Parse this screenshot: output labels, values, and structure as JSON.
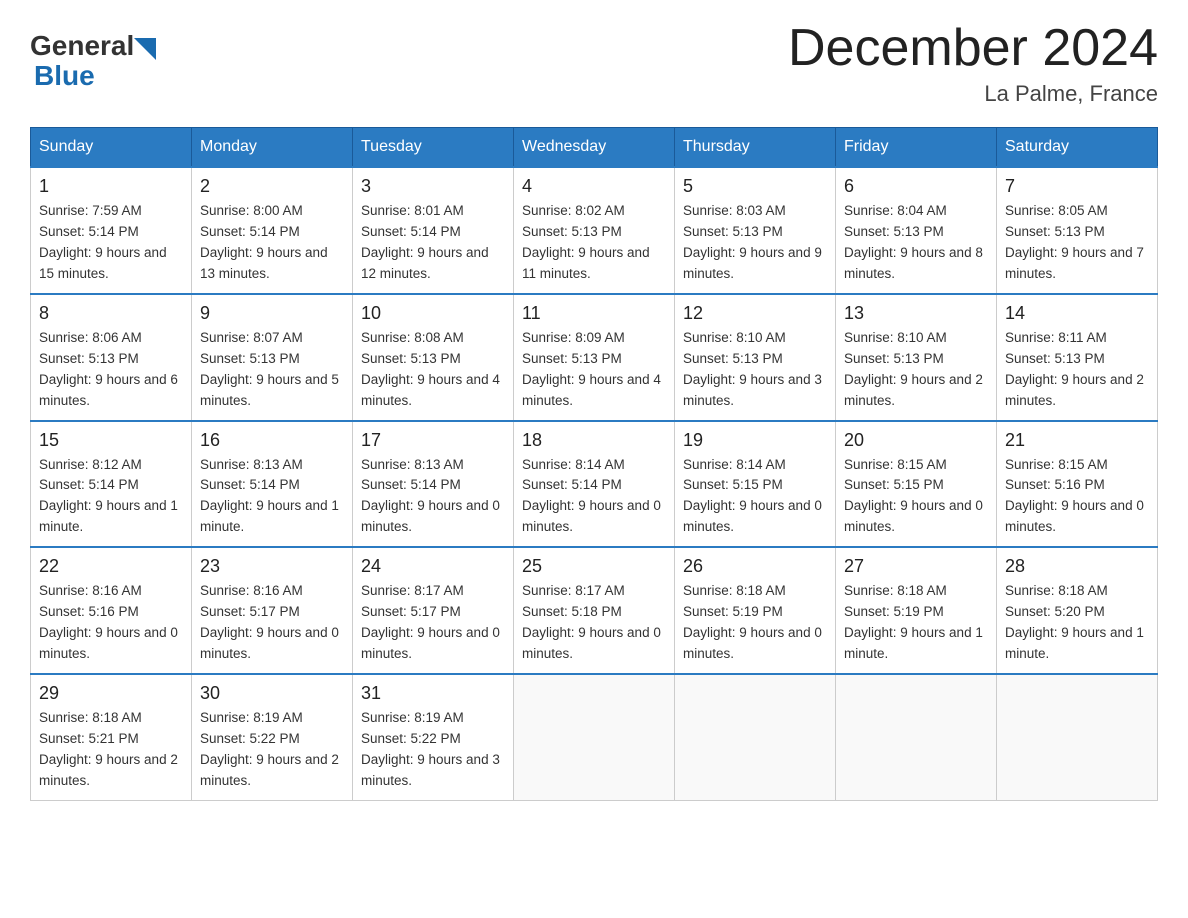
{
  "header": {
    "logo_general": "General",
    "logo_blue": "Blue",
    "title": "December 2024",
    "subtitle": "La Palme, France"
  },
  "weekdays": [
    "Sunday",
    "Monday",
    "Tuesday",
    "Wednesday",
    "Thursday",
    "Friday",
    "Saturday"
  ],
  "weeks": [
    [
      {
        "day": "1",
        "sunrise": "7:59 AM",
        "sunset": "5:14 PM",
        "daylight": "9 hours and 15 minutes."
      },
      {
        "day": "2",
        "sunrise": "8:00 AM",
        "sunset": "5:14 PM",
        "daylight": "9 hours and 13 minutes."
      },
      {
        "day": "3",
        "sunrise": "8:01 AM",
        "sunset": "5:14 PM",
        "daylight": "9 hours and 12 minutes."
      },
      {
        "day": "4",
        "sunrise": "8:02 AM",
        "sunset": "5:13 PM",
        "daylight": "9 hours and 11 minutes."
      },
      {
        "day": "5",
        "sunrise": "8:03 AM",
        "sunset": "5:13 PM",
        "daylight": "9 hours and 9 minutes."
      },
      {
        "day": "6",
        "sunrise": "8:04 AM",
        "sunset": "5:13 PM",
        "daylight": "9 hours and 8 minutes."
      },
      {
        "day": "7",
        "sunrise": "8:05 AM",
        "sunset": "5:13 PM",
        "daylight": "9 hours and 7 minutes."
      }
    ],
    [
      {
        "day": "8",
        "sunrise": "8:06 AM",
        "sunset": "5:13 PM",
        "daylight": "9 hours and 6 minutes."
      },
      {
        "day": "9",
        "sunrise": "8:07 AM",
        "sunset": "5:13 PM",
        "daylight": "9 hours and 5 minutes."
      },
      {
        "day": "10",
        "sunrise": "8:08 AM",
        "sunset": "5:13 PM",
        "daylight": "9 hours and 4 minutes."
      },
      {
        "day": "11",
        "sunrise": "8:09 AM",
        "sunset": "5:13 PM",
        "daylight": "9 hours and 4 minutes."
      },
      {
        "day": "12",
        "sunrise": "8:10 AM",
        "sunset": "5:13 PM",
        "daylight": "9 hours and 3 minutes."
      },
      {
        "day": "13",
        "sunrise": "8:10 AM",
        "sunset": "5:13 PM",
        "daylight": "9 hours and 2 minutes."
      },
      {
        "day": "14",
        "sunrise": "8:11 AM",
        "sunset": "5:13 PM",
        "daylight": "9 hours and 2 minutes."
      }
    ],
    [
      {
        "day": "15",
        "sunrise": "8:12 AM",
        "sunset": "5:14 PM",
        "daylight": "9 hours and 1 minute."
      },
      {
        "day": "16",
        "sunrise": "8:13 AM",
        "sunset": "5:14 PM",
        "daylight": "9 hours and 1 minute."
      },
      {
        "day": "17",
        "sunrise": "8:13 AM",
        "sunset": "5:14 PM",
        "daylight": "9 hours and 0 minutes."
      },
      {
        "day": "18",
        "sunrise": "8:14 AM",
        "sunset": "5:14 PM",
        "daylight": "9 hours and 0 minutes."
      },
      {
        "day": "19",
        "sunrise": "8:14 AM",
        "sunset": "5:15 PM",
        "daylight": "9 hours and 0 minutes."
      },
      {
        "day": "20",
        "sunrise": "8:15 AM",
        "sunset": "5:15 PM",
        "daylight": "9 hours and 0 minutes."
      },
      {
        "day": "21",
        "sunrise": "8:15 AM",
        "sunset": "5:16 PM",
        "daylight": "9 hours and 0 minutes."
      }
    ],
    [
      {
        "day": "22",
        "sunrise": "8:16 AM",
        "sunset": "5:16 PM",
        "daylight": "9 hours and 0 minutes."
      },
      {
        "day": "23",
        "sunrise": "8:16 AM",
        "sunset": "5:17 PM",
        "daylight": "9 hours and 0 minutes."
      },
      {
        "day": "24",
        "sunrise": "8:17 AM",
        "sunset": "5:17 PM",
        "daylight": "9 hours and 0 minutes."
      },
      {
        "day": "25",
        "sunrise": "8:17 AM",
        "sunset": "5:18 PM",
        "daylight": "9 hours and 0 minutes."
      },
      {
        "day": "26",
        "sunrise": "8:18 AM",
        "sunset": "5:19 PM",
        "daylight": "9 hours and 0 minutes."
      },
      {
        "day": "27",
        "sunrise": "8:18 AM",
        "sunset": "5:19 PM",
        "daylight": "9 hours and 1 minute."
      },
      {
        "day": "28",
        "sunrise": "8:18 AM",
        "sunset": "5:20 PM",
        "daylight": "9 hours and 1 minute."
      }
    ],
    [
      {
        "day": "29",
        "sunrise": "8:18 AM",
        "sunset": "5:21 PM",
        "daylight": "9 hours and 2 minutes."
      },
      {
        "day": "30",
        "sunrise": "8:19 AM",
        "sunset": "5:22 PM",
        "daylight": "9 hours and 2 minutes."
      },
      {
        "day": "31",
        "sunrise": "8:19 AM",
        "sunset": "5:22 PM",
        "daylight": "9 hours and 3 minutes."
      },
      null,
      null,
      null,
      null
    ]
  ],
  "labels": {
    "sunrise": "Sunrise:",
    "sunset": "Sunset:",
    "daylight": "Daylight:"
  }
}
